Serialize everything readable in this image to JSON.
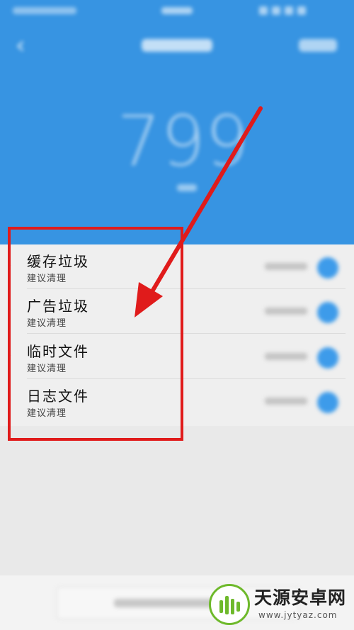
{
  "header": {
    "big_number": "799"
  },
  "list": {
    "items": [
      {
        "title": "缓存垃圾",
        "subtitle": "建议清理"
      },
      {
        "title": "广告垃圾",
        "subtitle": "建议清理"
      },
      {
        "title": "临时文件",
        "subtitle": "建议清理"
      },
      {
        "title": "日志文件",
        "subtitle": "建议清理"
      }
    ]
  },
  "colors": {
    "header_blue": "#3794e2",
    "accent_blue": "#3d9bea",
    "annotation_red": "#e01b1b"
  },
  "watermark": {
    "name": "天源安卓网",
    "url": "www.jytyaz.com"
  }
}
